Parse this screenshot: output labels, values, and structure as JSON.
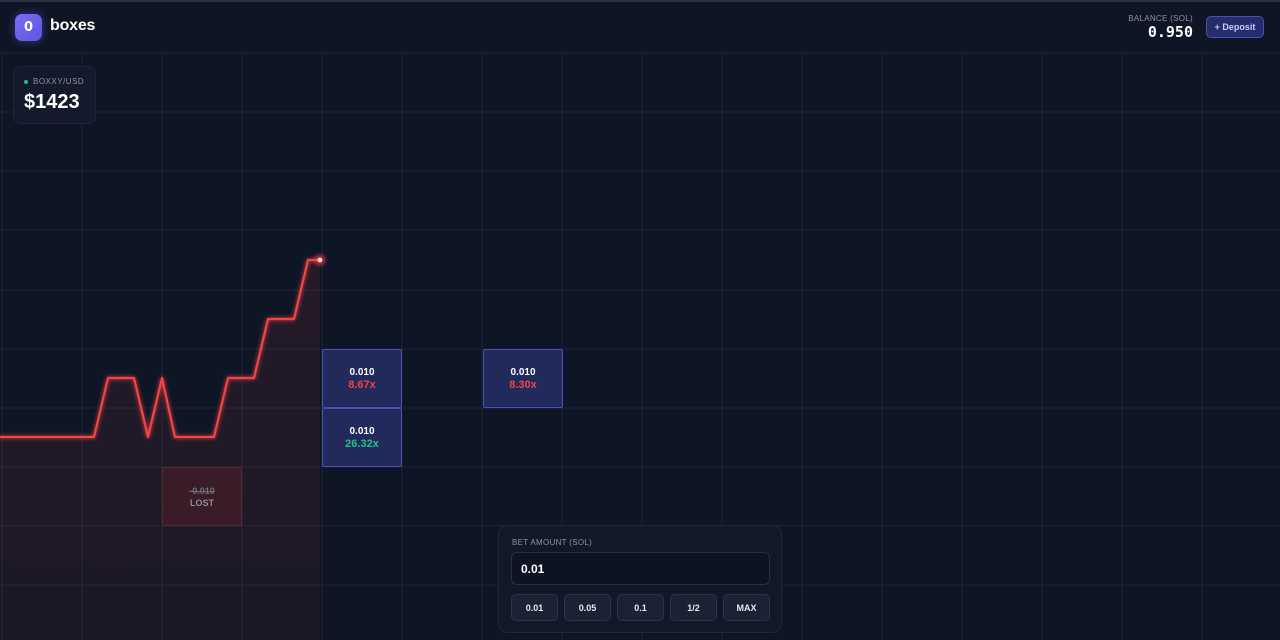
{
  "header": {
    "brand": "boxes",
    "logo_glyph": "0",
    "logo_icon": "box-logo-icon",
    "balance_label": "BALANCE (SOL)",
    "balance_value": "0.950",
    "deposit_label": "+ Deposit"
  },
  "ticker": {
    "pair": "BOXXY/USD",
    "price": "$1423",
    "status_color": "#22c087"
  },
  "bet_boxes": [
    {
      "amount": "0.010",
      "multiplier": "8.67x",
      "tone": "red"
    },
    {
      "amount": "0.010",
      "multiplier": "26.32x",
      "tone": "green"
    },
    {
      "amount": "0.010",
      "multiplier": "8.30x",
      "tone": "red"
    }
  ],
  "lost_box": {
    "amount": "-0.010",
    "label": "LOST"
  },
  "bet_panel": {
    "label": "BET AMOUNT (SOL)",
    "value": "0.01",
    "quick_amounts": [
      "0.01",
      "0.05",
      "0.1",
      "1/2",
      "MAX"
    ]
  },
  "colors": {
    "background": "#0e1525",
    "price_line": "#ef4444",
    "accent": "#5b55e0",
    "win": "#22c087",
    "loss": "#ef4444"
  }
}
